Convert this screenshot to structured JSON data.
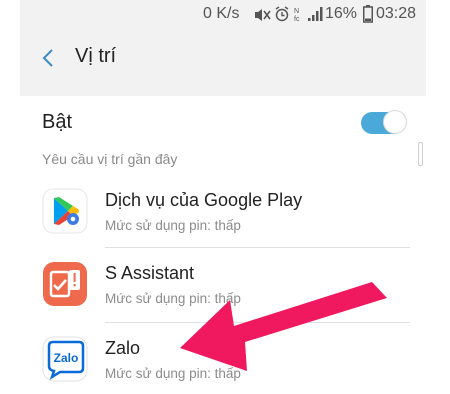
{
  "status_bar": {
    "net_speed": "0 K/s",
    "battery": "16%",
    "time": "03:28",
    "icons": [
      "mute-icon",
      "alarm-icon",
      "nfc-icon",
      "signal-icon",
      "battery-icon"
    ]
  },
  "header": {
    "title": "Vị trí"
  },
  "location_toggle": {
    "label": "Bật",
    "on": true
  },
  "recent_requests": {
    "header": "Yêu cầu vị trí gần đây",
    "apps": [
      {
        "name": "Dịch vụ của Google Play",
        "battery_usage": "Mức sử dụng pin: thấp",
        "icon": "google-play-services-icon"
      },
      {
        "name": "S Assistant",
        "battery_usage": "Mức sử dụng pin: thấp",
        "icon": "s-assistant-icon"
      },
      {
        "name": "Zalo",
        "battery_usage": "Mức sử dụng pin: thấp",
        "icon": "zalo-icon"
      }
    ]
  },
  "colors": {
    "accent": "#4aa9d8",
    "annotation_arrow": "#f0185f",
    "s_assistant": "#ef6a4c",
    "zalo": "#0a6ad8"
  }
}
